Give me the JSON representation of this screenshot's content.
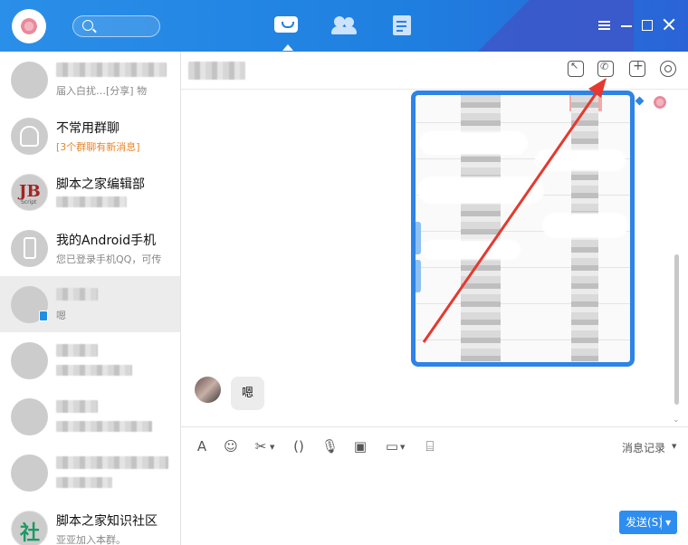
{
  "titlebar": {
    "tabs": [
      {
        "icon": "chat-bubble-icon",
        "active": true
      },
      {
        "icon": "contacts-icon",
        "active": false
      },
      {
        "icon": "documents-icon",
        "active": false
      }
    ],
    "controls": [
      "menu-icon",
      "minimize-icon",
      "maximize-icon",
      "close-icon"
    ],
    "accent_color": "#1f7fe0"
  },
  "sidebar": {
    "items": [
      {
        "name": "",
        "preview": "届入白扰…[分享] 物",
        "selected": false
      },
      {
        "name": "不常用群聊",
        "preview": "[3个群聊有新消息]",
        "selected": false
      },
      {
        "name": "脚本之家编辑部",
        "preview": "",
        "selected": false,
        "avatar_text": "JB",
        "avatar_sub": "Script"
      },
      {
        "name": "我的Android手机",
        "preview": "您已登录手机QQ，可传",
        "selected": false
      },
      {
        "name": "",
        "preview": "嗯",
        "selected": true
      },
      {
        "name": "",
        "preview": "",
        "selected": false
      },
      {
        "name": "",
        "preview": "",
        "selected": false
      },
      {
        "name": "",
        "preview": "",
        "selected": false
      },
      {
        "name": "脚本之家知识社区",
        "preview": "亚亚加入本群。",
        "selected": false,
        "avatar_text": "社"
      }
    ]
  },
  "chat": {
    "header_icons": [
      "share-screen-icon",
      "voice-call-icon",
      "add-member-icon",
      "settings-icon"
    ],
    "received_message": "嗯"
  },
  "composer": {
    "tools": [
      "font-icon",
      "emoji-icon",
      "scissors-icon",
      "shake-icon",
      "microphone-icon",
      "image-icon",
      "folder-icon",
      "red-packet-icon"
    ],
    "history_label": "消息记录",
    "send_label": "发送(S)",
    "send_color": "#2e8df0"
  },
  "annotation": {
    "arrow_color": "#e5392f"
  }
}
